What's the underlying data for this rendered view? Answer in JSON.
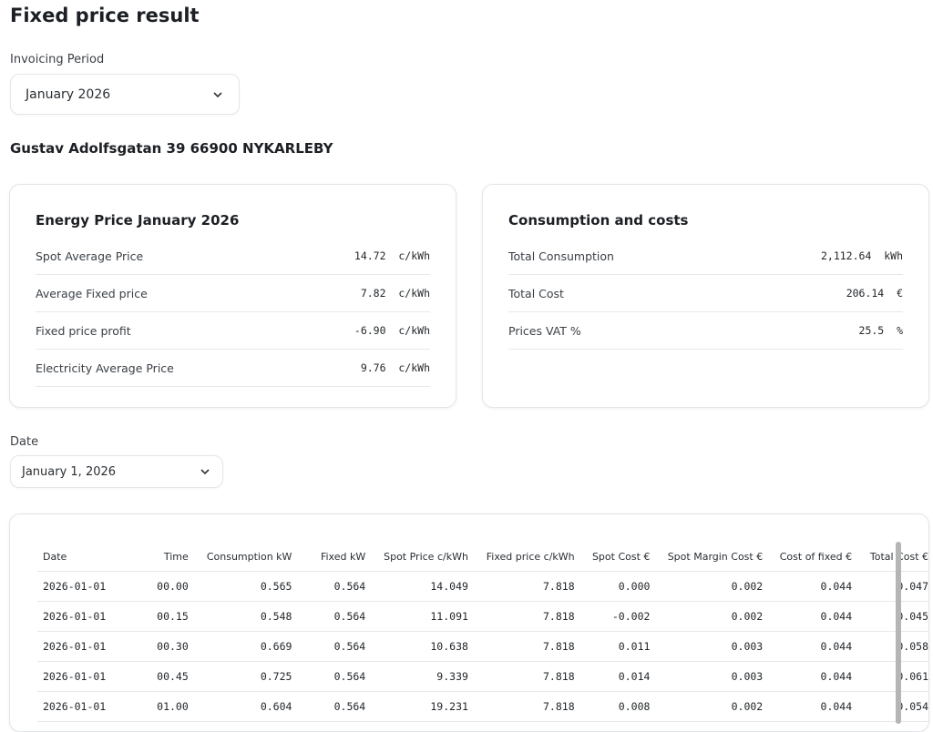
{
  "page": {
    "title": "Fixed price result",
    "invoicing_label": "Invoicing Period",
    "invoicing_value": "January 2026",
    "address": "Gustav Adolfsgatan 39 66900 NYKARLEBY",
    "date_label": "Date",
    "date_value": "January 1, 2026"
  },
  "energy": {
    "title": "Energy Price January 2026",
    "rows": [
      {
        "label": "Spot Average Price",
        "value": "14.72  c/kWh"
      },
      {
        "label": "Average Fixed price",
        "value": "7.82  c/kWh"
      },
      {
        "label": "Fixed price profit",
        "value": "-6.90  c/kWh"
      },
      {
        "label": "Electricity Average Price",
        "value": "9.76  c/kWh"
      }
    ]
  },
  "consumption": {
    "title": "Consumption and costs",
    "rows": [
      {
        "label": "Total Consumption",
        "value": "2,112.64  kWh"
      },
      {
        "label": "Total Cost",
        "value": "206.14  €"
      },
      {
        "label": "Prices VAT %",
        "value": "25.5  %"
      }
    ]
  },
  "table": {
    "headers": [
      "Date",
      "Time",
      "Consumption kW",
      "Fixed kW",
      "Spot Price c/kWh",
      "Fixed price c/kWh",
      "Spot Cost €",
      "Spot Margin Cost €",
      "Cost of fixed €",
      "Total Cost €"
    ],
    "rows": [
      [
        "2026-01-01",
        "00.00",
        "0.565",
        "0.564",
        "14.049",
        "7.818",
        "0.000",
        "0.002",
        "0.044",
        "0.047"
      ],
      [
        "2026-01-01",
        "00.15",
        "0.548",
        "0.564",
        "11.091",
        "7.818",
        "-0.002",
        "0.002",
        "0.044",
        "0.045"
      ],
      [
        "2026-01-01",
        "00.30",
        "0.669",
        "0.564",
        "10.638",
        "7.818",
        "0.011",
        "0.003",
        "0.044",
        "0.058"
      ],
      [
        "2026-01-01",
        "00.45",
        "0.725",
        "0.564",
        "9.339",
        "7.818",
        "0.014",
        "0.003",
        "0.044",
        "0.061"
      ],
      [
        "2026-01-01",
        "01.00",
        "0.604",
        "0.564",
        "19.231",
        "7.818",
        "0.008",
        "0.002",
        "0.044",
        "0.054"
      ]
    ]
  }
}
